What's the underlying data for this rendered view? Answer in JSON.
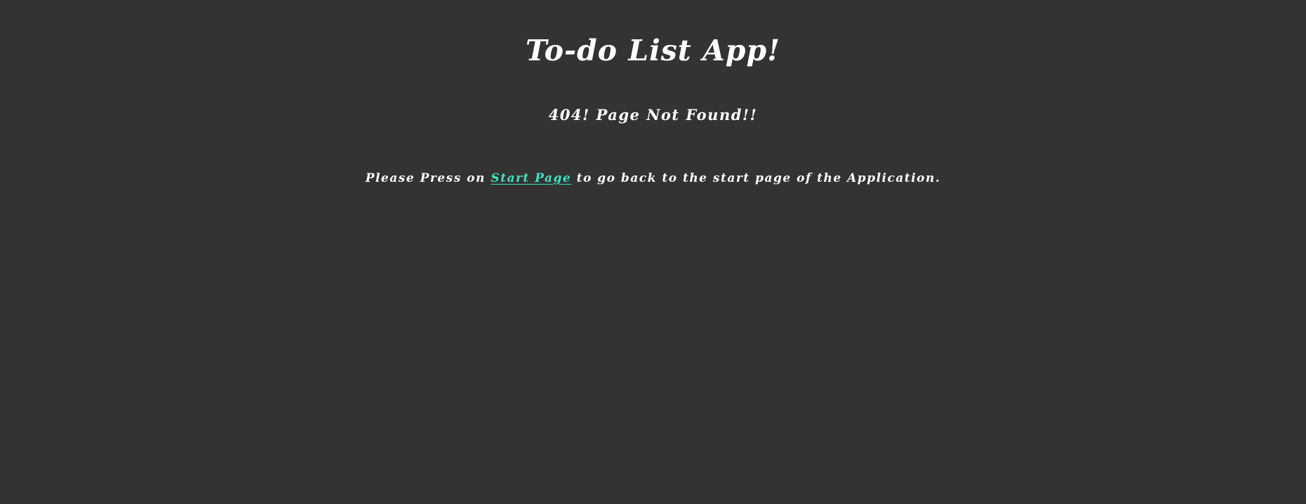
{
  "header": {
    "title": "To-do List App!"
  },
  "error": {
    "heading": "404! Page Not Found!!"
  },
  "instructions": {
    "prefix": "Please Press on ",
    "link_text": "Start Page",
    "suffix": " to go back to the start page of the Application."
  },
  "colors": {
    "background": "#333333",
    "text": "#ffffff",
    "link": "#40e0c0"
  }
}
